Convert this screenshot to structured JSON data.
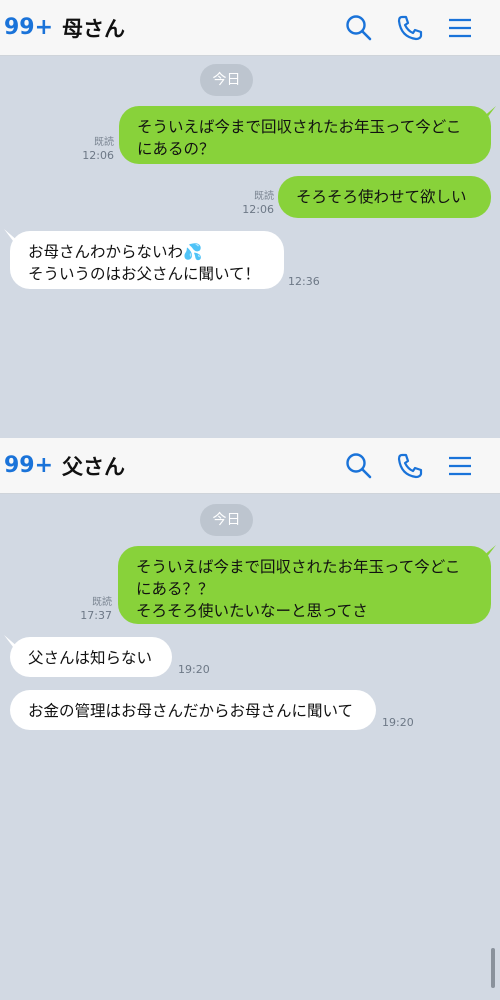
{
  "chats": [
    {
      "unread_badge": "99+",
      "title": "母さん",
      "icons": [
        "search-icon",
        "phone-icon",
        "menu-icon"
      ],
      "date_label": "今日",
      "messages": [
        {
          "from": "me",
          "text": "そういえば今まで回収されたお年玉って今どこ\nにあるの？",
          "read": "既読",
          "time": "12:06"
        },
        {
          "from": "me",
          "text": "そろそろ使わせて欲しい",
          "read": "既読",
          "time": "12:06"
        },
        {
          "from": "them",
          "text": "お母さんわからないわ💦\nそういうのはお父さんに聞いて！",
          "time": "12:36"
        }
      ]
    },
    {
      "unread_badge": "99+",
      "title": "父さん",
      "icons": [
        "search-icon",
        "phone-icon",
        "menu-icon"
      ],
      "date_label": "今日",
      "messages": [
        {
          "from": "me",
          "text": "そういえば今まで回収されたお年玉って今どこ\nにある？？\nそろそろ使いたいなーと思ってさ",
          "read": "既読",
          "time": "17:37"
        },
        {
          "from": "them",
          "text": "父さんは知らない",
          "time": "19:20"
        },
        {
          "from": "them",
          "text": "お金の管理はお母さんだからお母さんに聞いて",
          "time": "19:20"
        }
      ]
    }
  ],
  "colors": {
    "background": "#d2d9e3",
    "my_bubble": "#88d23a",
    "their_bubble": "#ffffff",
    "accent": "#1a73d9"
  }
}
